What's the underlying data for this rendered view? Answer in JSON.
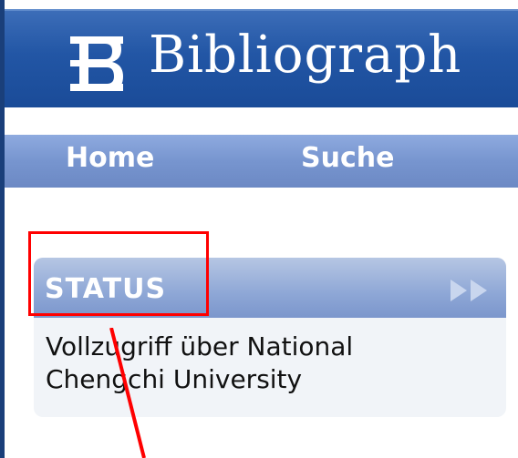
{
  "header": {
    "title": "Bibliograph",
    "logo_icon": "b-logo-icon",
    "background": "#2256a5"
  },
  "nav": {
    "items": [
      {
        "label": "Home"
      },
      {
        "label": "Suche"
      }
    ]
  },
  "status": {
    "title": "STATUS",
    "line1": "Vollzugriff über National",
    "line2": "Chengchi University",
    "expand_icon": "double-chevron-right-icon"
  },
  "annotations": {
    "highlight_color": "#ff0000"
  }
}
